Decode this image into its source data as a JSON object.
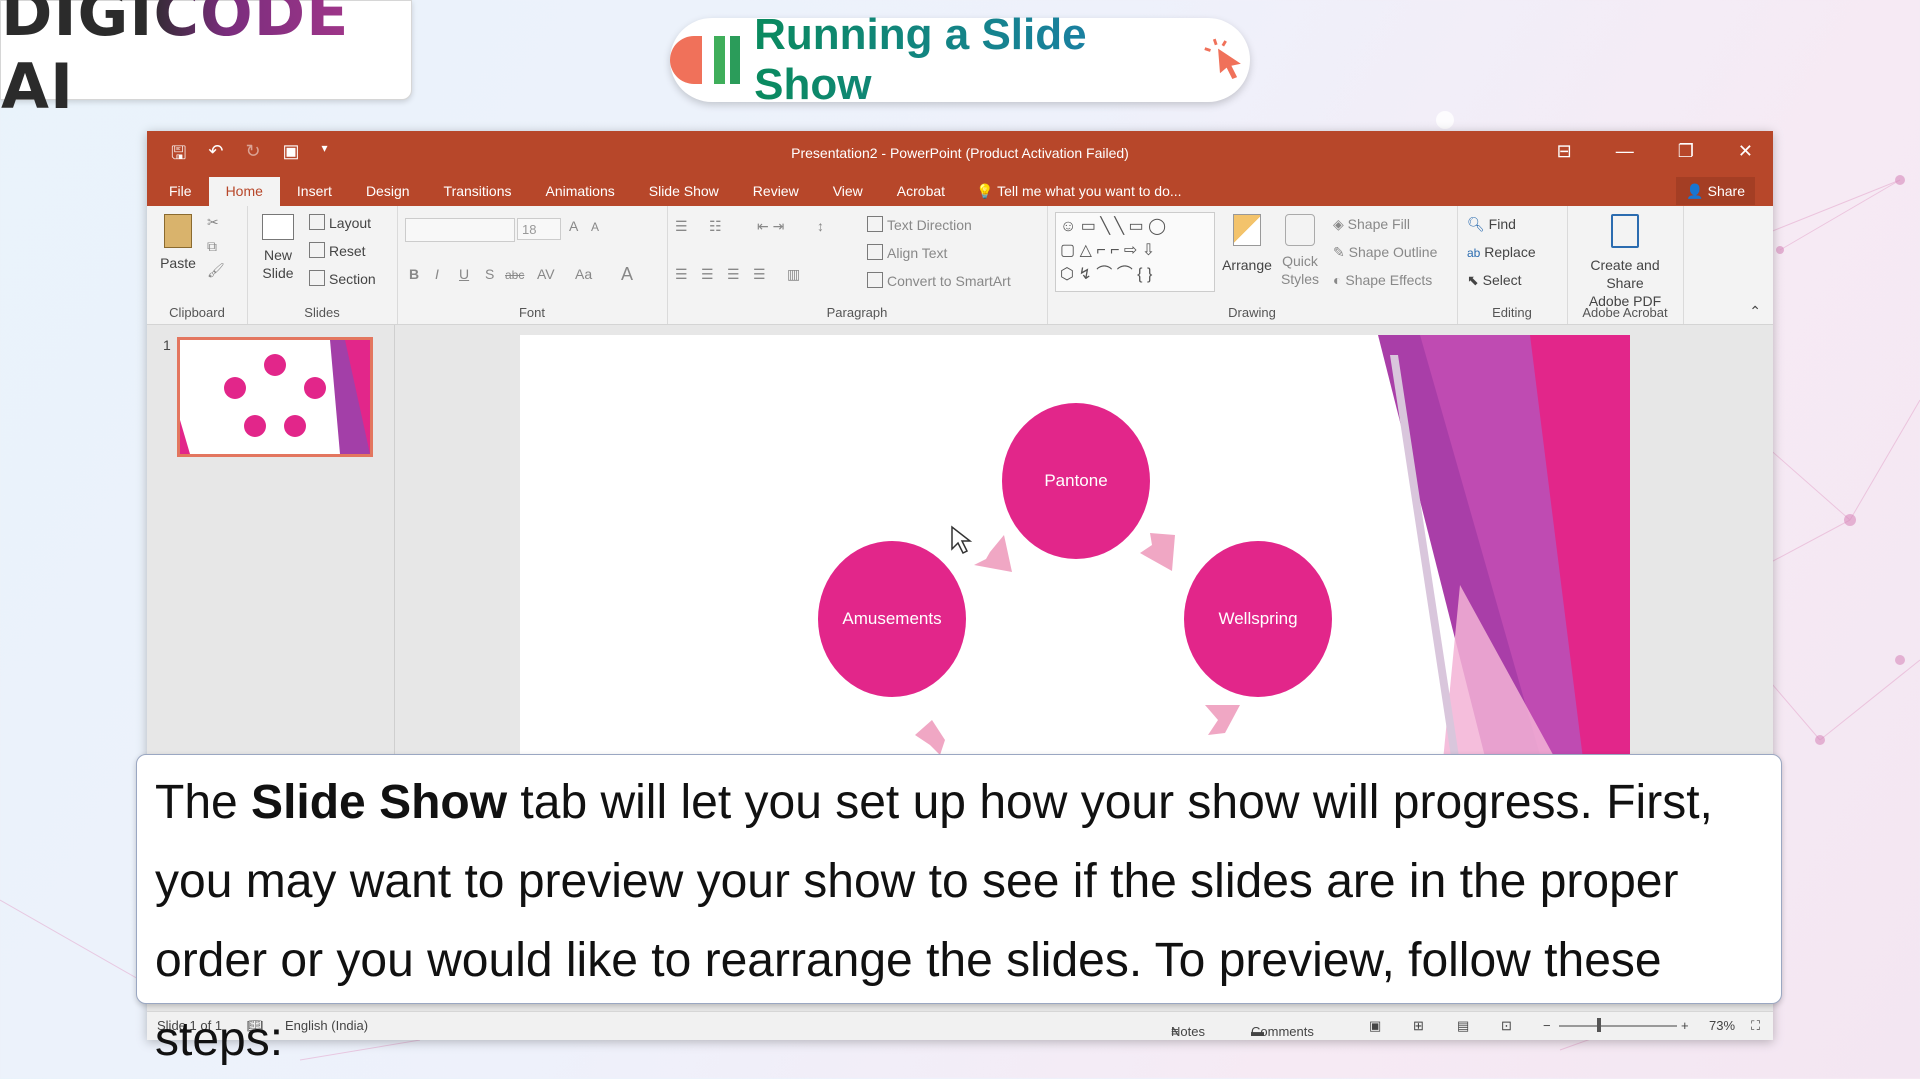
{
  "brand": {
    "logo_text": "DIGICODE AI"
  },
  "heading": {
    "title": "Running a Slide Show",
    "cursor_icon": "cursor-click-icon"
  },
  "app": {
    "window_title": "Presentation2 - PowerPoint (Product Activation Failed)",
    "qat_icons": [
      "save-icon",
      "undo-icon",
      "redo-icon",
      "start-from-beginning-icon",
      "customize-qat-icon"
    ],
    "window_controls": [
      "ribbon-display-options-icon",
      "minimize-icon",
      "restore-icon",
      "close-icon"
    ],
    "tabs": [
      "File",
      "Home",
      "Insert",
      "Design",
      "Transitions",
      "Animations",
      "Slide Show",
      "Review",
      "View",
      "Acrobat"
    ],
    "active_tab": "Home",
    "tell_me": "Tell me what you want to do...",
    "share": "Share"
  },
  "ribbon": {
    "clipboard": {
      "label": "Clipboard",
      "paste": "Paste"
    },
    "slides": {
      "label": "Slides",
      "new_slide_1": "New",
      "new_slide_2": "Slide",
      "layout": "Layout",
      "reset": "Reset",
      "section": "Section"
    },
    "font": {
      "label": "Font",
      "size": "18",
      "bold": "B",
      "italic": "I",
      "underline": "U",
      "shadow": "S",
      "strike": "abc",
      "spacing": "AV",
      "case": "Aa",
      "color": "A",
      "grow": "A",
      "shrink": "A"
    },
    "paragraph": {
      "label": "Paragraph",
      "text_direction": "Text Direction",
      "align_text": "Align Text",
      "smartart": "Convert to SmartArt"
    },
    "drawing": {
      "label": "Drawing",
      "arrange": "Arrange",
      "quick_1": "Quick",
      "quick_2": "Styles",
      "shape_fill": "Shape Fill",
      "shape_outline": "Shape Outline",
      "shape_effects": "Shape Effects"
    },
    "editing": {
      "label": "Editing",
      "find": "Find",
      "replace": "Replace",
      "select": "Select"
    },
    "acrobat": {
      "label": "Adobe Acrobat",
      "create_1": "Create and Share",
      "create_2": "Adobe PDF"
    }
  },
  "thumbnail": {
    "number": "1"
  },
  "slide": {
    "nodes": [
      "Pantone",
      "Wellspring",
      "Amusements"
    ],
    "accent": "#e2268a",
    "arrow_color": "#f0a7c4"
  },
  "status_bar": {
    "slide": "Slide 1 of 1",
    "language": "English (India)",
    "notes": "Notes",
    "comments": "Comments",
    "zoom": "73%"
  },
  "caption": {
    "pre": "The ",
    "bold": "Slide Show",
    "post": " tab will let you set up how your show will progress. First, you may want to preview your show to see if the slides are in the proper order or you would like to rearrange the slides. To preview, follow these steps:"
  },
  "colors": {
    "ribbon": "#b7472a",
    "brand_green": "#0a8a5e",
    "brand_blue": "#1f7db6"
  }
}
